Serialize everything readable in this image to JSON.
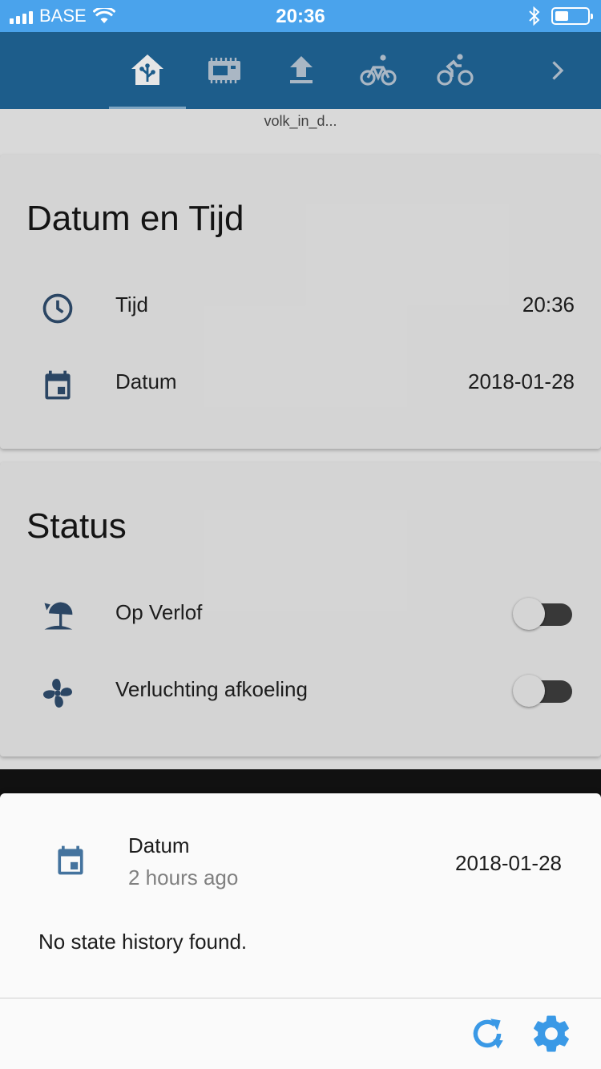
{
  "status_bar": {
    "carrier": "BASE",
    "time": "20:36"
  },
  "toolbar": {
    "tabs": [
      {
        "icon": "home-assistant-icon",
        "active": true
      },
      {
        "icon": "chip-icon",
        "active": false
      },
      {
        "icon": "upload-icon",
        "active": false
      },
      {
        "icon": "bicycle-icon",
        "active": false
      },
      {
        "icon": "cyclist-icon",
        "active": false
      }
    ],
    "more_icon": "chevron-right-icon"
  },
  "page": {
    "title": "volk_in_d..."
  },
  "cards": {
    "datetime": {
      "title": "Datum en Tijd",
      "rows": [
        {
          "icon": "clock-icon",
          "label": "Tijd",
          "value": "20:36"
        },
        {
          "icon": "calendar-icon",
          "label": "Datum",
          "value": "2018-01-28"
        }
      ]
    },
    "status": {
      "title": "Status",
      "rows": [
        {
          "icon": "beach-umbrella-icon",
          "label": "Op Verlof",
          "on": false
        },
        {
          "icon": "fan-icon",
          "label": "Verluchting afkoeling",
          "on": false
        }
      ]
    }
  },
  "sheet": {
    "entity_name": "Datum",
    "last_changed": "2 hours ago",
    "state": "2018-01-28",
    "history_message": "No state history found.",
    "actions": {
      "refresh_icon": "refresh-icon",
      "settings_icon": "gear-icon"
    }
  },
  "colors": {
    "status_bar": "#4aa3ec",
    "toolbar": "#1d5d8b",
    "icon": "#44739e",
    "accent": "#3a99e6"
  }
}
